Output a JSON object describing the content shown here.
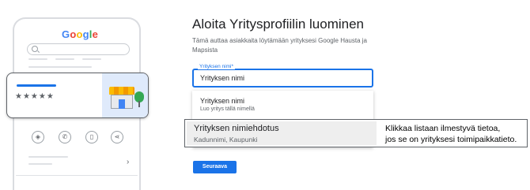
{
  "illustration": {
    "logo_letters": [
      "G",
      "o",
      "o",
      "g",
      "l",
      "e"
    ],
    "logo_colors": [
      "#4285f4",
      "#ea4335",
      "#fbbc04",
      "#4285f4",
      "#34a853",
      "#ea4335"
    ],
    "rating_stars": "★★★★★",
    "action_icons": [
      "directions-icon",
      "phone-icon",
      "bookmark-icon",
      "share-icon"
    ],
    "action_glyphs": [
      "◈",
      "✆",
      "▯",
      "⋖"
    ],
    "chevron": "›"
  },
  "form": {
    "title": "Aloita Yritysprofiilin luominen",
    "subtitle": "Tämä auttaa asiakkaita löytämään yrityksesi Google Hausta ja Mapsista",
    "field_label": "Yrityksen nimi*",
    "field_value": "Yrityksen nimi",
    "next_button": "Seuraava"
  },
  "suggestions": [
    {
      "title": "Yrityksen nimi",
      "subtitle": "Luo yritys tällä nimellä"
    },
    {
      "title": "Yrityksen nimiehdotus",
      "subtitle": "Kadunnimi, Kaupunki"
    }
  ],
  "annotation": {
    "line1": "Klikkaa listaan ilmestyvä tietoa,",
    "line2": "jos se on yrityksesi toimipaikkatieto."
  },
  "colors": {
    "accent": "#1a73e8",
    "highlight_bg": "#eeeeee"
  }
}
